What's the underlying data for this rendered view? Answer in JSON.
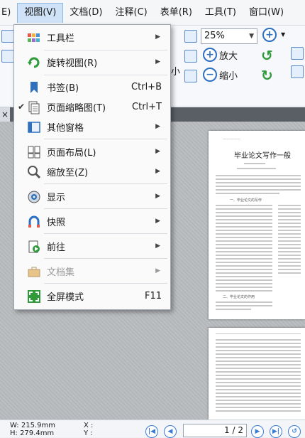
{
  "menubar": {
    "items": [
      {
        "label": "E)"
      },
      {
        "label": "视图(V)"
      },
      {
        "label": "文档(D)"
      },
      {
        "label": "注释(C)"
      },
      {
        "label": "表单(R)"
      },
      {
        "label": "工具(T)"
      },
      {
        "label": "窗口(W)"
      }
    ]
  },
  "ribbon": {
    "zoom_value": "25%",
    "zoom_in_label": "放大",
    "zoom_out_label": "缩小",
    "small_label": "小"
  },
  "view_menu": {
    "items": [
      {
        "label": "工具栏",
        "icon": "toolbar-icon"
      },
      {
        "label": "旋转视图(R)",
        "icon": "rotate-view-icon"
      },
      {
        "label": "书签(B)",
        "shortcut": "Ctrl+B",
        "icon": "bookmark-icon"
      },
      {
        "label": "页面缩略图(T)",
        "shortcut": "Ctrl+T",
        "checked": true,
        "icon": "page-thumbnails-icon"
      },
      {
        "label": "其他窗格",
        "icon": "other-panes-icon"
      },
      {
        "label": "页面布局(L)",
        "icon": "page-layout-icon"
      },
      {
        "label": "缩放至(Z)",
        "icon": "zoom-to-icon"
      },
      {
        "label": "显示",
        "icon": "display-icon"
      },
      {
        "label": "快照",
        "icon": "snapshot-icon"
      },
      {
        "label": "前往",
        "icon": "go-to-icon"
      },
      {
        "label": "文档集",
        "disabled": true,
        "icon": "portfolio-icon"
      },
      {
        "label": "全屏模式",
        "shortcut": "F11",
        "icon": "fullscreen-icon"
      }
    ]
  },
  "document": {
    "page1_title": "毕业论文写作一般",
    "page1_section": "一、毕业论文的写作",
    "page1_section2": "二、毕业论文的作用"
  },
  "statusbar": {
    "width_label": "W: 215.9mm",
    "height_label": "H: 279.4mm",
    "x_label": "X :",
    "y_label": "Y :",
    "page_indicator": "1 / 2"
  },
  "colors": {
    "accent": "#2f6fc0",
    "menu_highlight": "#cfe2f7"
  }
}
